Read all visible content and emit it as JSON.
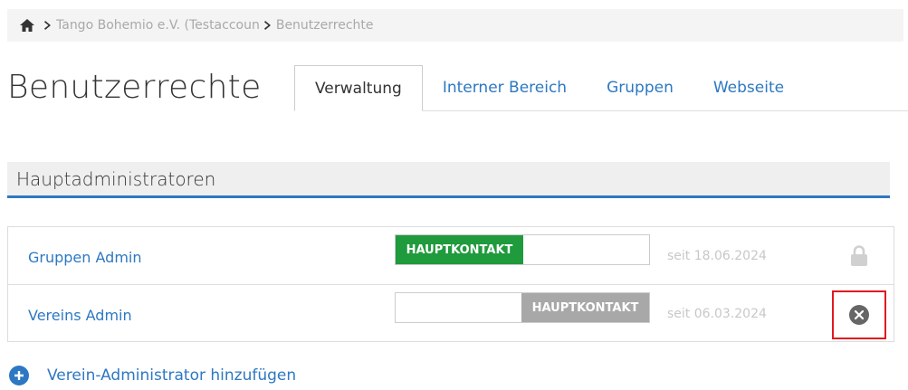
{
  "breadcrumb": {
    "items": [
      "Tango Bohemio e.V. (Testaccoun",
      "Benutzerrechte"
    ]
  },
  "page": {
    "title": "Benutzerrechte"
  },
  "tabs": [
    {
      "label": "Verwaltung",
      "active": true
    },
    {
      "label": "Interner Bereich",
      "active": false
    },
    {
      "label": "Gruppen",
      "active": false
    },
    {
      "label": "Webseite",
      "active": false
    }
  ],
  "section": {
    "title": "Hauptadministratoren"
  },
  "admins": [
    {
      "name": "Gruppen Admin",
      "contact_label": "HAUPTKONTAKT",
      "is_main_contact": true,
      "since": "seit 18.06.2024",
      "action": "lock-icon"
    },
    {
      "name": "Vereins Admin",
      "contact_label": "HAUPTKONTAKT",
      "is_main_contact": false,
      "since": "seit 06.03.2024",
      "action": "remove-icon"
    }
  ],
  "add_admin": {
    "label": "Verein-Administrator hinzufügen"
  },
  "colors": {
    "accent": "#2d78c2",
    "main_contact_on": "#1f9a3c",
    "main_contact_off": "#a8a8a8",
    "highlight": "#e0191f"
  }
}
